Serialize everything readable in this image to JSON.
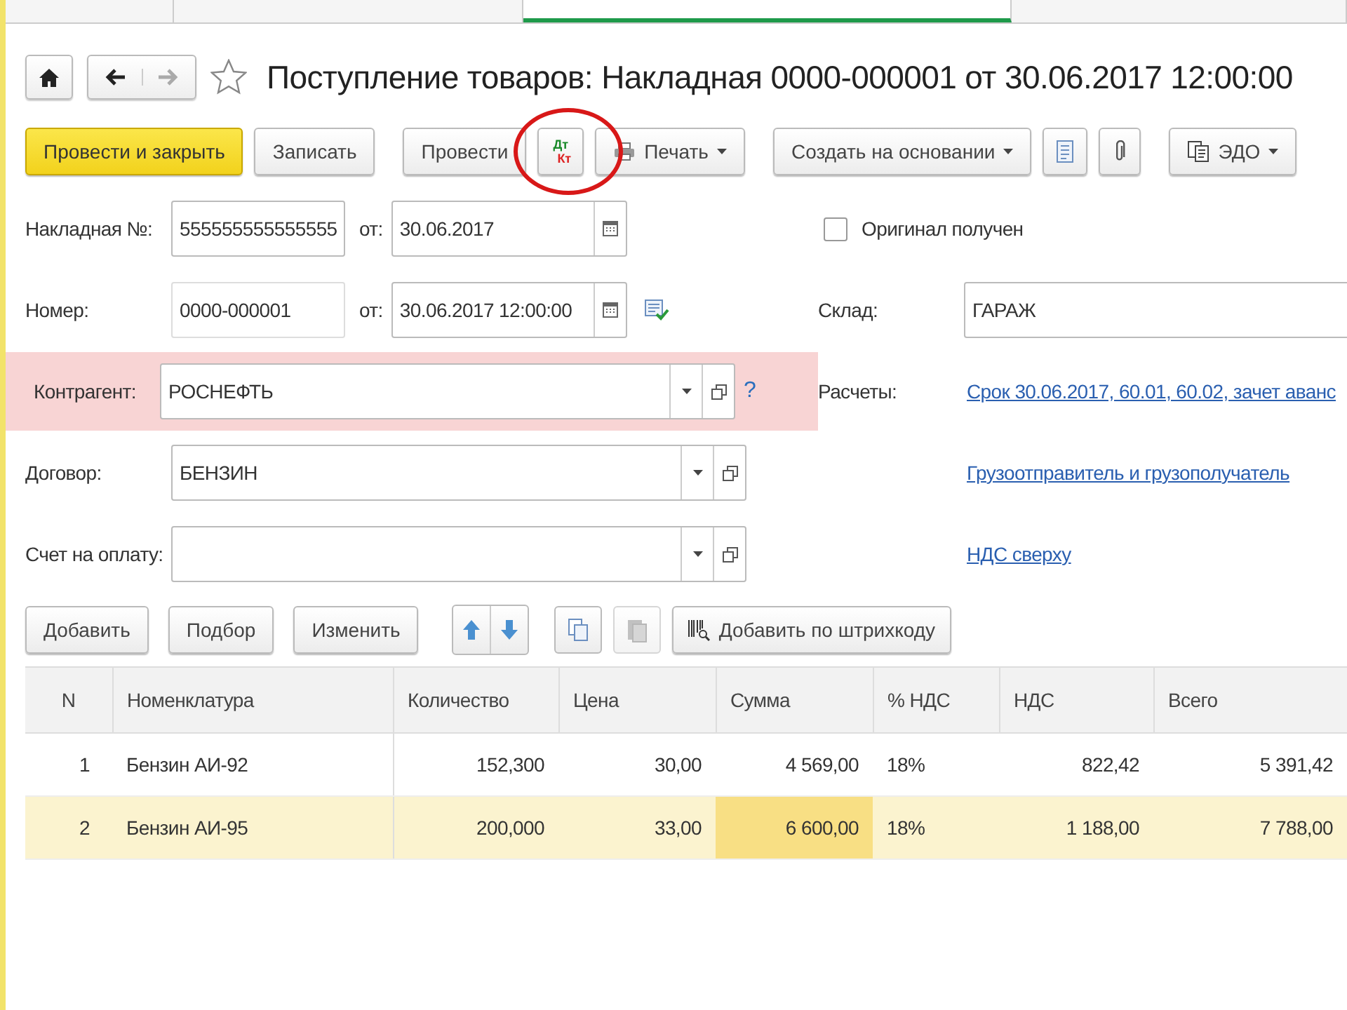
{
  "window_tabs": [
    {
      "selected": false
    },
    {
      "selected": false
    },
    {
      "selected": true
    },
    {
      "selected": false
    }
  ],
  "header": {
    "title": "Поступление товаров: Накладная 0000-000001 от 30.06.2017 12:00:00",
    "favorite": false
  },
  "toolbar": [
    {
      "kind": "primary",
      "label": "Провести и закрыть"
    },
    {
      "kind": "button",
      "label": "Записать"
    },
    {
      "kind": "button",
      "label": "Провести"
    },
    {
      "kind": "dtkt",
      "top": "Дт",
      "bottom": "Кт",
      "circled": true
    },
    {
      "kind": "print",
      "label": "Печать"
    },
    {
      "kind": "dropdown",
      "label": "Создать на основании"
    },
    {
      "kind": "report"
    },
    {
      "kind": "attach"
    },
    {
      "kind": "edo",
      "label": "ЭДО"
    }
  ],
  "form": {
    "invoice_no": {
      "label": "Накладная №:",
      "value": "555555555555555",
      "date_label": "от:",
      "date": "30.06.2017"
    },
    "original_received": {
      "label": "Оригинал получен",
      "checked": false
    },
    "number": {
      "label": "Номер:",
      "value": "0000-000001",
      "date_label": "от:",
      "date": "30.06.2017 12:00:00"
    },
    "warehouse": {
      "label": "Склад:",
      "value": "ГАРАЖ"
    },
    "counterparty": {
      "label": "Контрагент:",
      "value": "РОСНЕФТЬ",
      "highlighted": true,
      "help": "?"
    },
    "settlements": {
      "label": "Расчеты:",
      "link": "Срок 30.06.2017, 60.01, 60.02, зачет аванс"
    },
    "contract": {
      "label": "Договор:",
      "value": "БЕНЗИН",
      "highlighted": false
    },
    "shipper_link": "Грузоотправитель и грузополучатель",
    "payment_invoice": {
      "label": "Счет на оплату:",
      "highlighted": false
    },
    "vat_link": "НДС сверху"
  },
  "table_toolbar": [
    {
      "kind": "button",
      "label": "Добавить"
    },
    {
      "kind": "button",
      "label": "Подбор"
    },
    {
      "kind": "button",
      "label": "Изменить"
    },
    {
      "kind": "updown"
    },
    {
      "kind": "copy"
    },
    {
      "kind": "paste"
    },
    {
      "kind": "barcode",
      "label": "Добавить по штрихкоду"
    }
  ],
  "table": {
    "columns": [
      "N",
      "Номенклатура",
      "Количество",
      "Цена",
      "Сумма",
      "% НДС",
      "НДС",
      "Всего"
    ],
    "rows": [
      {
        "selected": false,
        "cells": [
          {
            "text": "1",
            "focused": false
          },
          {
            "text": "Бензин АИ-92",
            "focused": false
          },
          {
            "text": "152,300",
            "focused": false
          },
          {
            "text": "30,00",
            "focused": false
          },
          {
            "text": "4 569,00",
            "focused": false
          },
          {
            "text": "18%",
            "focused": false
          },
          {
            "text": "822,42",
            "focused": false
          },
          {
            "text": "5 391,42",
            "focused": false
          }
        ]
      },
      {
        "selected": true,
        "cells": [
          {
            "text": "2",
            "focused": false
          },
          {
            "text": "Бензин АИ-95",
            "focused": false
          },
          {
            "text": "200,000",
            "focused": false
          },
          {
            "text": "33,00",
            "focused": false
          },
          {
            "text": "6 600,00",
            "focused": true
          },
          {
            "text": "18%",
            "focused": false
          },
          {
            "text": "1 188,00",
            "focused": false
          },
          {
            "text": "7 788,00",
            "focused": false
          }
        ]
      }
    ]
  }
}
